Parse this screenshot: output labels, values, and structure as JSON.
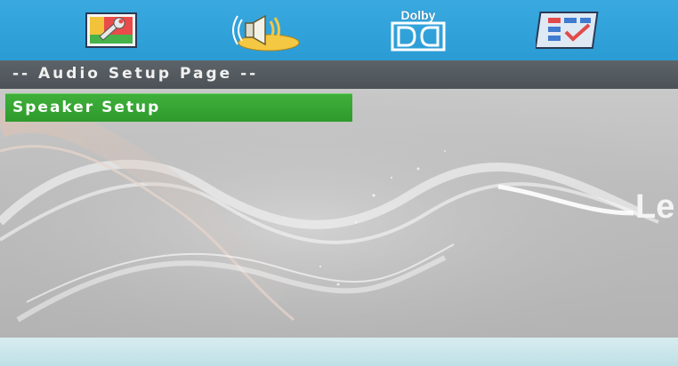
{
  "top_menu": {
    "items": [
      {
        "id": "general-setup",
        "icon": "wrench-picture-icon"
      },
      {
        "id": "audio-setup",
        "icon": "speaker-icon",
        "selected": true
      },
      {
        "id": "dolby-setup",
        "icon": "dolby-icon",
        "label": "Dolby"
      },
      {
        "id": "preference-setup",
        "icon": "checklist-icon"
      }
    ],
    "colors": {
      "bar": "#39a9e0"
    }
  },
  "page": {
    "title": "-- Audio Setup Page --"
  },
  "menu": {
    "items": [
      {
        "label": "Speaker Setup",
        "selected": true
      }
    ],
    "colors": {
      "highlight": "#36a533"
    }
  },
  "brand": {
    "text": "Le"
  }
}
